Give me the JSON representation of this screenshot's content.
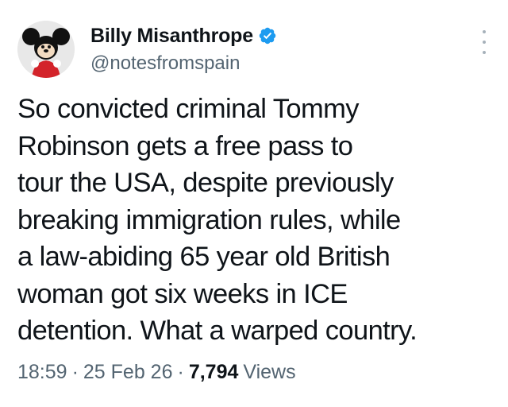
{
  "author": {
    "display_name": "Billy Misanthrope",
    "handle": "@notesfromspain",
    "verified": true,
    "avatar_icon": "cartoon-mouse-avatar"
  },
  "tweet": {
    "text": "So convicted criminal Tommy\nRobinson gets a free pass to\ntour the USA, despite previously\nbreaking immigration rules, while\na law-abiding 65 year old British\nwoman got six weeks in ICE\ndetention. What a warped country."
  },
  "meta": {
    "time": "18:59",
    "separator": "·",
    "date": "25 Feb 26",
    "views_count": "7,794",
    "views_label": "Views"
  },
  "colors": {
    "text_primary": "#0f1419",
    "text_secondary": "#536471",
    "verified_blue": "#1d9bf0",
    "background": "#ffffff"
  },
  "icons": {
    "verified": "verified-badge-icon",
    "more": "more-options-icon"
  }
}
